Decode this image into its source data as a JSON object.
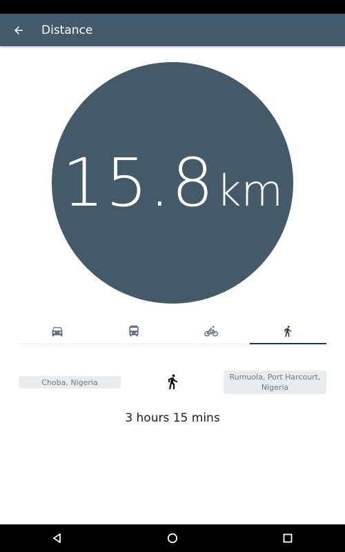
{
  "app_bar": {
    "title": "Distance",
    "back_icon": "arrow-left-icon",
    "color": "#435b6b"
  },
  "distance": {
    "value": "15.8",
    "unit": "km",
    "circle_color": "#445a68"
  },
  "modes": [
    {
      "icon": "car-icon",
      "active": false
    },
    {
      "icon": "bus-icon",
      "active": false
    },
    {
      "icon": "bicycle-icon",
      "active": false
    },
    {
      "icon": "walk-icon",
      "active": true
    }
  ],
  "route": {
    "origin": "Choba, Nigeria",
    "destination": "Rumuola, Port Harcourt, Nigeria",
    "mode_icon": "walk-icon",
    "duration": "3 hours 15 mins"
  },
  "nav": {
    "back_icon": "triangle-back-icon",
    "home_icon": "circle-home-icon",
    "recents_icon": "square-recents-icon"
  },
  "colors": {
    "accent": "#1f2f6b",
    "chip_bg": "#e9ecef"
  }
}
